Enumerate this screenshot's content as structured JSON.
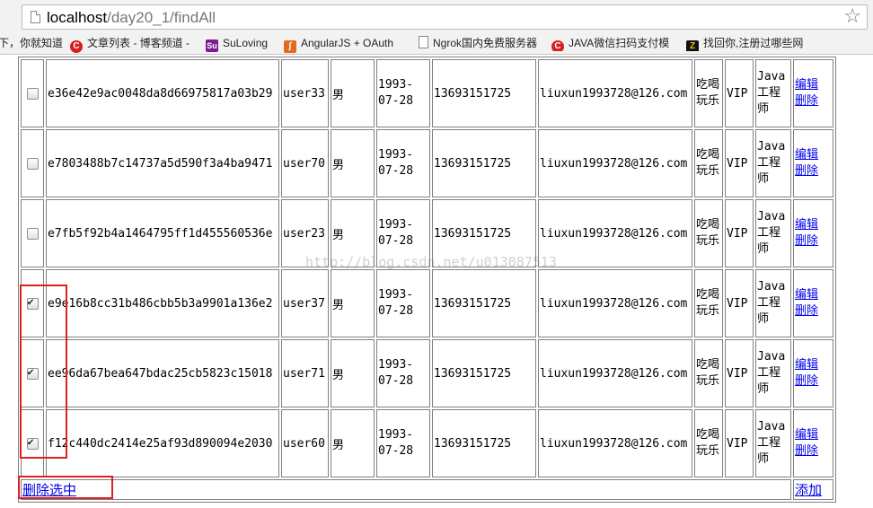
{
  "browser": {
    "host": "localhost",
    "path": "/day20_1/findAll",
    "bookmarks": [
      {
        "label": "下，你就知道",
        "icon": "none"
      },
      {
        "label": "文章列表 - 博客频道 -",
        "icon": "csdn-icon"
      },
      {
        "label": "SuLoving",
        "icon": "su-icon"
      },
      {
        "label": "AngularJS + OAuth",
        "icon": "angular-icon"
      },
      {
        "label": "Ngrok国内免费服务器",
        "icon": "document-icon"
      },
      {
        "label": "JAVA微信扫码支付模",
        "icon": "csdn-icon"
      },
      {
        "label": "找回你,注册过哪些网",
        "icon": "z-icon"
      }
    ]
  },
  "users": [
    {
      "checked": false,
      "id": "e36e42e9ac0048da8d66975817a03b29",
      "name": "user33",
      "sex": "男",
      "birthday": "1993-07-28",
      "phone": "13693151725",
      "email": "liuxun1993728@126.com",
      "hobby": "吃喝玩乐",
      "type": "VIP",
      "job": "Java工程师"
    },
    {
      "checked": false,
      "id": "e7803488b7c14737a5d590f3a4ba9471",
      "name": "user70",
      "sex": "男",
      "birthday": "1993-07-28",
      "phone": "13693151725",
      "email": "liuxun1993728@126.com",
      "hobby": "吃喝玩乐",
      "type": "VIP",
      "job": "Java工程师"
    },
    {
      "checked": false,
      "id": "e7fb5f92b4a1464795ff1d455560536e",
      "name": "user23",
      "sex": "男",
      "birthday": "1993-07-28",
      "phone": "13693151725",
      "email": "liuxun1993728@126.com",
      "hobby": "吃喝玩乐",
      "type": "VIP",
      "job": "Java工程师"
    },
    {
      "checked": true,
      "id": "e9e16b8cc31b486cbb5b3a9901a136e2",
      "name": "user37",
      "sex": "男",
      "birthday": "1993-07-28",
      "phone": "13693151725",
      "email": "liuxun1993728@126.com",
      "hobby": "吃喝玩乐",
      "type": "VIP",
      "job": "Java工程师"
    },
    {
      "checked": true,
      "id": "ee96da67bea647bdac25cb5823c15018",
      "name": "user71",
      "sex": "男",
      "birthday": "1993-07-28",
      "phone": "13693151725",
      "email": "liuxun1993728@126.com",
      "hobby": "吃喝玩乐",
      "type": "VIP",
      "job": "Java工程师"
    },
    {
      "checked": true,
      "id": "f12c440dc2414e25af93d890094e2030",
      "name": "user60",
      "sex": "男",
      "birthday": "1993-07-28",
      "phone": "13693151725",
      "email": "liuxun1993728@126.com",
      "hobby": "吃喝玩乐",
      "type": "VIP",
      "job": "Java工程师"
    }
  ],
  "actions": {
    "edit": "编辑",
    "delete": "删除",
    "delete_selected": "删除选中",
    "add": "添加"
  },
  "watermark": "http://blog.csdn.net/u013087513",
  "colors": {
    "link": "#0000ee",
    "highlight": "#e02020"
  }
}
